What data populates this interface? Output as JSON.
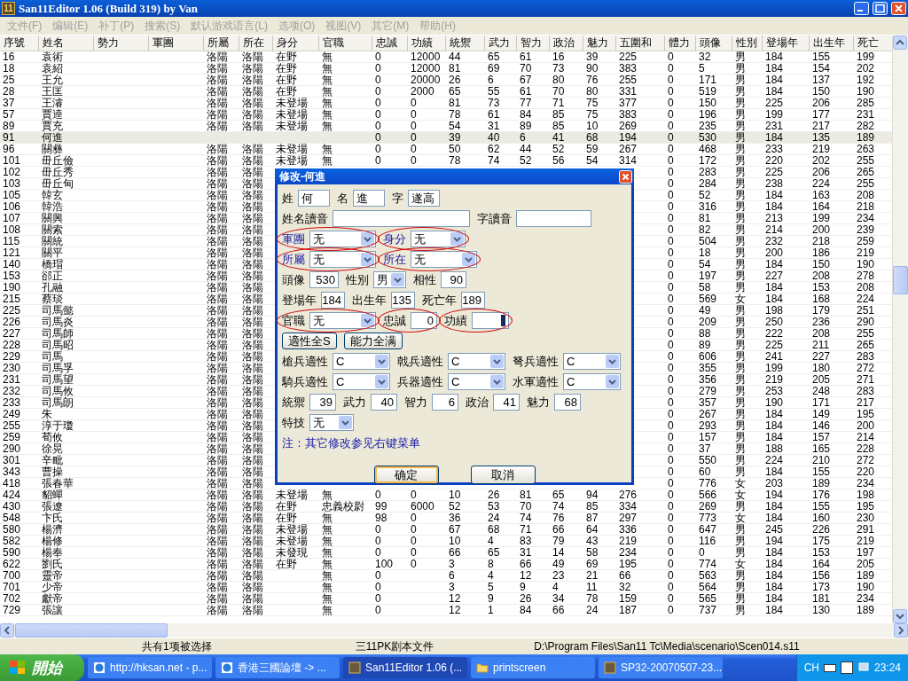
{
  "window": {
    "logo": "11",
    "title": "San11Editor 1.06 (Build 319) by Van"
  },
  "menu": [
    {
      "label": "文件(F)",
      "disabled": true
    },
    {
      "label": "编辑(E)",
      "disabled": true
    },
    {
      "label": "补丁(P)",
      "disabled": true
    },
    {
      "label": "搜索(S)",
      "disabled": true
    },
    {
      "label": "默认游戏语言(L)",
      "disabled": true
    },
    {
      "label": "选项(O)",
      "disabled": true
    },
    {
      "label": "视图(V)",
      "disabled": true
    },
    {
      "label": "其它(M)",
      "disabled": true
    },
    {
      "label": "帮助(H)",
      "disabled": true
    }
  ],
  "table": {
    "columns": [
      "序號",
      "姓名",
      "勢力",
      "軍團",
      "所屬",
      "所在",
      "身分",
      "官職",
      "忠誠",
      "功績",
      "統禦",
      "武力",
      "智力",
      "政治",
      "魅力",
      "五圍和",
      "體力",
      "頭像",
      "性別",
      "登場年",
      "出生年",
      "死亡"
    ],
    "rows": [
      {
        "selected": false,
        "cells": [
          "16",
          "袁術",
          null,
          null,
          "洛陽",
          "洛陽",
          "在野",
          "無",
          "0",
          "12000",
          "44",
          "65",
          "61",
          "16",
          "39",
          "225",
          "0",
          "32",
          "男",
          "184",
          "155",
          "199"
        ]
      },
      {
        "selected": false,
        "cells": [
          "18",
          "袁紹",
          null,
          null,
          "洛陽",
          "洛陽",
          "在野",
          "無",
          "0",
          "12000",
          "81",
          "69",
          "70",
          "73",
          "90",
          "383",
          "0",
          "5",
          "男",
          "184",
          "154",
          "202"
        ]
      },
      {
        "selected": false,
        "cells": [
          "25",
          "王允",
          null,
          null,
          "洛陽",
          "洛陽",
          "在野",
          "無",
          "0",
          "20000",
          "26",
          "6",
          "67",
          "80",
          "76",
          "255",
          "0",
          "171",
          "男",
          "184",
          "137",
          "192"
        ]
      },
      {
        "selected": false,
        "cells": [
          "28",
          "王匡",
          null,
          null,
          "洛陽",
          "洛陽",
          "在野",
          "無",
          "0",
          "2000",
          "65",
          "55",
          "61",
          "70",
          "80",
          "331",
          "0",
          "519",
          "男",
          "184",
          "150",
          "190"
        ]
      },
      {
        "selected": false,
        "cells": [
          "37",
          "王濬",
          null,
          null,
          "洛陽",
          "洛陽",
          "未登場",
          "無",
          "0",
          "0",
          "81",
          "73",
          "77",
          "71",
          "75",
          "377",
          "0",
          "150",
          "男",
          "225",
          "206",
          "285"
        ]
      },
      {
        "selected": false,
        "cells": [
          "57",
          "賈逵",
          null,
          null,
          "洛陽",
          "洛陽",
          "未登場",
          "無",
          "0",
          "0",
          "78",
          "61",
          "84",
          "85",
          "75",
          "383",
          "0",
          "196",
          "男",
          "199",
          "177",
          "231"
        ]
      },
      {
        "selected": false,
        "cells": [
          "89",
          "賈充",
          null,
          null,
          "洛陽",
          "洛陽",
          "未登場",
          "無",
          "0",
          "0",
          "54",
          "31",
          "89",
          "85",
          "10",
          "269",
          "0",
          "235",
          "男",
          "231",
          "217",
          "282"
        ]
      },
      {
        "selected": true,
        "cells": [
          "91",
          "何進",
          null,
          null,
          null,
          null,
          null,
          null,
          "0",
          "0",
          "39",
          "40",
          "6",
          "41",
          "68",
          "194",
          "0",
          "530",
          "男",
          "184",
          "135",
          "189"
        ]
      },
      {
        "selected": false,
        "cells": [
          "96",
          "關彝",
          null,
          null,
          "洛陽",
          "洛陽",
          "未登場",
          "無",
          "0",
          "0",
          "50",
          "62",
          "44",
          "52",
          "59",
          "267",
          "0",
          "468",
          "男",
          "233",
          "219",
          "263"
        ]
      },
      {
        "selected": false,
        "cells": [
          "101",
          "毌丘儉",
          null,
          null,
          "洛陽",
          "洛陽",
          "未登場",
          "無",
          "0",
          "0",
          "78",
          "74",
          "52",
          "56",
          "54",
          "314",
          "0",
          "172",
          "男",
          "220",
          "202",
          "255"
        ]
      },
      {
        "selected": false,
        "cells": [
          "102",
          "毌丘秀",
          null,
          null,
          "洛陽",
          "洛陽",
          null,
          null,
          null,
          null,
          null,
          null,
          null,
          null,
          null,
          null,
          "0",
          "283",
          "男",
          "225",
          "206",
          "265"
        ]
      },
      {
        "selected": false,
        "cells": [
          "103",
          "毌丘甸",
          null,
          null,
          "洛陽",
          "洛陽",
          null,
          null,
          null,
          null,
          null,
          null,
          null,
          null,
          null,
          null,
          "0",
          "284",
          "男",
          "238",
          "224",
          "255"
        ]
      },
      {
        "selected": false,
        "cells": [
          "105",
          "韓玄",
          null,
          null,
          "洛陽",
          "洛陽",
          null,
          null,
          null,
          null,
          null,
          null,
          null,
          null,
          null,
          null,
          "0",
          "52",
          "男",
          "184",
          "163",
          "208"
        ]
      },
      {
        "selected": false,
        "cells": [
          "106",
          "韓浩",
          null,
          null,
          "洛陽",
          "洛陽",
          null,
          null,
          null,
          null,
          null,
          null,
          null,
          null,
          null,
          null,
          "0",
          "316",
          "男",
          "184",
          "164",
          "218"
        ]
      },
      {
        "selected": false,
        "cells": [
          "107",
          "關興",
          null,
          null,
          "洛陽",
          "洛陽",
          null,
          null,
          null,
          null,
          null,
          null,
          null,
          null,
          null,
          null,
          "0",
          "81",
          "男",
          "213",
          "199",
          "234"
        ]
      },
      {
        "selected": false,
        "cells": [
          "108",
          "關索",
          null,
          null,
          "洛陽",
          "洛陽",
          null,
          null,
          null,
          null,
          null,
          null,
          null,
          null,
          null,
          null,
          "0",
          "82",
          "男",
          "214",
          "200",
          "239"
        ]
      },
      {
        "selected": false,
        "cells": [
          "115",
          "關統",
          null,
          null,
          "洛陽",
          "洛陽",
          null,
          null,
          null,
          null,
          null,
          null,
          null,
          null,
          null,
          null,
          "0",
          "504",
          "男",
          "232",
          "218",
          "259"
        ]
      },
      {
        "selected": false,
        "cells": [
          "121",
          "關平",
          null,
          null,
          "洛陽",
          "洛陽",
          null,
          null,
          null,
          null,
          null,
          null,
          null,
          null,
          null,
          null,
          "0",
          "18",
          "男",
          "200",
          "186",
          "219"
        ]
      },
      {
        "selected": false,
        "cells": [
          "140",
          "橋瑁",
          null,
          null,
          "洛陽",
          "洛陽",
          null,
          null,
          null,
          null,
          null,
          null,
          null,
          null,
          null,
          null,
          "0",
          "54",
          "男",
          "184",
          "150",
          "190"
        ]
      },
      {
        "selected": false,
        "cells": [
          "153",
          "郤正",
          null,
          null,
          "洛陽",
          "洛陽",
          null,
          null,
          null,
          null,
          null,
          null,
          null,
          null,
          null,
          null,
          "0",
          "197",
          "男",
          "227",
          "208",
          "278"
        ]
      },
      {
        "selected": false,
        "cells": [
          "190",
          "孔融",
          null,
          null,
          "洛陽",
          "洛陽",
          null,
          null,
          null,
          null,
          null,
          null,
          null,
          null,
          null,
          null,
          "0",
          "58",
          "男",
          "184",
          "153",
          "208"
        ]
      },
      {
        "selected": false,
        "cells": [
          "215",
          "蔡琰",
          null,
          null,
          "洛陽",
          "洛陽",
          null,
          null,
          null,
          null,
          null,
          null,
          null,
          null,
          null,
          null,
          "0",
          "569",
          "女",
          "184",
          "168",
          "224"
        ]
      },
      {
        "selected": false,
        "cells": [
          "225",
          "司馬懿",
          null,
          null,
          "洛陽",
          "洛陽",
          null,
          null,
          null,
          null,
          null,
          null,
          null,
          null,
          null,
          null,
          "0",
          "49",
          "男",
          "198",
          "179",
          "251"
        ]
      },
      {
        "selected": false,
        "cells": [
          "226",
          "司馬炎",
          null,
          null,
          "洛陽",
          "洛陽",
          null,
          null,
          null,
          null,
          null,
          null,
          null,
          null,
          null,
          null,
          "0",
          "209",
          "男",
          "250",
          "236",
          "290"
        ]
      },
      {
        "selected": false,
        "cells": [
          "227",
          "司馬師",
          null,
          null,
          "洛陽",
          "洛陽",
          null,
          null,
          null,
          null,
          null,
          null,
          null,
          null,
          null,
          null,
          "0",
          "88",
          "男",
          "222",
          "208",
          "255"
        ]
      },
      {
        "selected": false,
        "cells": [
          "228",
          "司馬昭",
          null,
          null,
          "洛陽",
          "洛陽",
          null,
          null,
          null,
          null,
          null,
          null,
          null,
          null,
          null,
          null,
          "0",
          "89",
          "男",
          "225",
          "211",
          "265"
        ]
      },
      {
        "selected": false,
        "cells": [
          "229",
          "司馬",
          null,
          null,
          "洛陽",
          "洛陽",
          null,
          null,
          null,
          null,
          null,
          null,
          null,
          null,
          null,
          null,
          "0",
          "606",
          "男",
          "241",
          "227",
          "283"
        ]
      },
      {
        "selected": false,
        "cells": [
          "230",
          "司馬孚",
          null,
          null,
          "洛陽",
          "洛陽",
          null,
          null,
          null,
          null,
          null,
          null,
          null,
          null,
          null,
          null,
          "0",
          "355",
          "男",
          "199",
          "180",
          "272"
        ]
      },
      {
        "selected": false,
        "cells": [
          "231",
          "司馬望",
          null,
          null,
          "洛陽",
          "洛陽",
          null,
          null,
          null,
          null,
          null,
          null,
          null,
          null,
          null,
          null,
          "0",
          "356",
          "男",
          "219",
          "205",
          "271"
        ]
      },
      {
        "selected": false,
        "cells": [
          "232",
          "司馬攸",
          null,
          null,
          "洛陽",
          "洛陽",
          null,
          null,
          null,
          null,
          null,
          null,
          null,
          null,
          null,
          null,
          "0",
          "279",
          "男",
          "253",
          "248",
          "283"
        ]
      },
      {
        "selected": false,
        "cells": [
          "233",
          "司馬朗",
          null,
          null,
          "洛陽",
          "洛陽",
          null,
          null,
          null,
          null,
          null,
          null,
          null,
          null,
          null,
          null,
          "0",
          "357",
          "男",
          "190",
          "171",
          "217"
        ]
      },
      {
        "selected": false,
        "cells": [
          "249",
          "朱",
          null,
          null,
          "洛陽",
          "洛陽",
          null,
          null,
          null,
          null,
          null,
          null,
          null,
          null,
          null,
          null,
          "0",
          "267",
          "男",
          "184",
          "149",
          "195"
        ]
      },
      {
        "selected": false,
        "cells": [
          "255",
          "淳于瓊",
          null,
          null,
          "洛陽",
          "洛陽",
          null,
          null,
          null,
          null,
          null,
          null,
          null,
          null,
          null,
          null,
          "0",
          "293",
          "男",
          "184",
          "146",
          "200"
        ]
      },
      {
        "selected": false,
        "cells": [
          "259",
          "荀攸",
          null,
          null,
          "洛陽",
          "洛陽",
          null,
          null,
          null,
          null,
          null,
          null,
          null,
          null,
          null,
          null,
          "0",
          "157",
          "男",
          "184",
          "157",
          "214"
        ]
      },
      {
        "selected": false,
        "cells": [
          "290",
          "徐晃",
          null,
          null,
          "洛陽",
          "洛陽",
          null,
          null,
          null,
          null,
          null,
          null,
          null,
          null,
          null,
          null,
          "0",
          "37",
          "男",
          "188",
          "165",
          "228"
        ]
      },
      {
        "selected": false,
        "cells": [
          "301",
          "辛毗",
          null,
          null,
          "洛陽",
          "洛陽",
          null,
          null,
          null,
          null,
          null,
          null,
          null,
          null,
          null,
          null,
          "0",
          "550",
          "男",
          "224",
          "210",
          "272"
        ]
      },
      {
        "selected": false,
        "cells": [
          "343",
          "曹操",
          null,
          null,
          "洛陽",
          "洛陽",
          null,
          null,
          null,
          null,
          null,
          null,
          null,
          null,
          null,
          null,
          "0",
          "60",
          "男",
          "184",
          "155",
          "220"
        ]
      },
      {
        "selected": false,
        "cells": [
          "418",
          "張春華",
          null,
          null,
          "洛陽",
          "洛陽",
          null,
          null,
          null,
          null,
          null,
          null,
          null,
          null,
          null,
          null,
          "0",
          "776",
          "女",
          "203",
          "189",
          "234"
        ]
      },
      {
        "selected": false,
        "cells": [
          "424",
          "貂蟬",
          null,
          null,
          "洛陽",
          "洛陽",
          "未登場",
          "無",
          "0",
          "0",
          "10",
          "26",
          "81",
          "65",
          "94",
          "276",
          "0",
          "566",
          "女",
          "194",
          "176",
          "198"
        ]
      },
      {
        "selected": false,
        "cells": [
          "430",
          "張遼",
          null,
          null,
          "洛陽",
          "洛陽",
          "在野",
          "忠義校尉",
          "99",
          "6000",
          "52",
          "53",
          "70",
          "74",
          "85",
          "334",
          "0",
          "269",
          "男",
          "184",
          "155",
          "195"
        ]
      },
      {
        "selected": false,
        "cells": [
          "548",
          "卞氏",
          null,
          null,
          "洛陽",
          "洛陽",
          "在野",
          "無",
          "98",
          "0",
          "36",
          "24",
          "74",
          "76",
          "87",
          "297",
          "0",
          "773",
          "女",
          "184",
          "160",
          "230"
        ]
      },
      {
        "selected": false,
        "cells": [
          "580",
          "楊濟",
          null,
          null,
          "洛陽",
          "洛陽",
          "未登場",
          "無",
          "0",
          "0",
          "67",
          "68",
          "71",
          "66",
          "64",
          "336",
          "0",
          "647",
          "男",
          "245",
          "226",
          "291"
        ]
      },
      {
        "selected": false,
        "cells": [
          "582",
          "楊修",
          null,
          null,
          "洛陽",
          "洛陽",
          "未登場",
          "無",
          "0",
          "0",
          "10",
          "4",
          "83",
          "79",
          "43",
          "219",
          "0",
          "116",
          "男",
          "194",
          "175",
          "219"
        ]
      },
      {
        "selected": false,
        "cells": [
          "590",
          "楊奉",
          null,
          null,
          "洛陽",
          "洛陽",
          "未發現",
          "無",
          "0",
          "0",
          "66",
          "65",
          "31",
          "14",
          "58",
          "234",
          "0",
          "0",
          "男",
          "184",
          "153",
          "197"
        ]
      },
      {
        "selected": false,
        "cells": [
          "622",
          "劉氏",
          null,
          null,
          "洛陽",
          "洛陽",
          "在野",
          "無",
          "100",
          "0",
          "3",
          "8",
          "66",
          "49",
          "69",
          "195",
          "0",
          "774",
          "女",
          "184",
          "164",
          "205"
        ]
      },
      {
        "selected": false,
        "cells": [
          "700",
          "靈帝",
          null,
          null,
          "洛陽",
          "洛陽",
          null,
          "無",
          "0",
          null,
          "6",
          "4",
          "12",
          "23",
          "21",
          "66",
          "0",
          "563",
          "男",
          "184",
          "156",
          "189"
        ]
      },
      {
        "selected": false,
        "cells": [
          "701",
          "少帝",
          null,
          null,
          "洛陽",
          "洛陽",
          null,
          "無",
          "0",
          null,
          "3",
          "5",
          "9",
          "4",
          "11",
          "32",
          "0",
          "564",
          "男",
          "184",
          "173",
          "190"
        ]
      },
      {
        "selected": false,
        "cells": [
          "702",
          "獻帝",
          null,
          null,
          "洛陽",
          "洛陽",
          null,
          "無",
          "0",
          null,
          "12",
          "9",
          "26",
          "34",
          "78",
          "159",
          "0",
          "565",
          "男",
          "184",
          "181",
          "234"
        ]
      },
      {
        "selected": false,
        "cells": [
          "729",
          "張讓",
          null,
          null,
          "洛陽",
          "洛陽",
          null,
          "無",
          "0",
          null,
          "12",
          "1",
          "84",
          "66",
          "24",
          "187",
          "0",
          "737",
          "男",
          "184",
          "130",
          "189"
        ]
      }
    ]
  },
  "dialog": {
    "title": "修改-何進",
    "rows": [
      {
        "kind": "fields",
        "fields": [
          {
            "label": "姓",
            "kind": "text",
            "value": "何"
          },
          {
            "label": "名",
            "kind": "text",
            "value": "進"
          },
          {
            "label": "字",
            "kind": "text",
            "value": "遂高"
          }
        ]
      },
      {
        "kind": "fields",
        "fields": [
          {
            "label": "姓名讀音",
            "kind": "text"
          },
          {
            "label": "字讀音",
            "kind": "text"
          }
        ]
      },
      {
        "kind": "fields",
        "fields": [
          {
            "label": "軍團",
            "kind": "combo",
            "value": "无",
            "circled": true,
            "link": true
          },
          {
            "label": "身分",
            "kind": "combo",
            "value": "无",
            "circled": true,
            "link": true
          }
        ]
      },
      {
        "kind": "fields",
        "fields": [
          {
            "label": "所屬",
            "kind": "combo",
            "value": "无",
            "circled": true,
            "link": true
          },
          {
            "label": "所在",
            "kind": "combo",
            "value": "无",
            "circled": true,
            "link": true
          }
        ]
      },
      {
        "kind": "fields",
        "fields": [
          {
            "label": "頭像",
            "kind": "number",
            "value": "530"
          },
          {
            "label": "性別",
            "kind": "combo",
            "value": "男"
          },
          {
            "label": "相性",
            "kind": "number",
            "value": "90"
          }
        ]
      },
      {
        "kind": "fields",
        "fields": [
          {
            "label": "登場年",
            "kind": "number",
            "value": "184"
          },
          {
            "label": "出生年",
            "kind": "number",
            "value": "135"
          },
          {
            "label": "死亡年",
            "kind": "number",
            "value": "189"
          }
        ]
      },
      {
        "kind": "fields",
        "fields": [
          {
            "label": "官職",
            "kind": "combo",
            "value": "无",
            "circled": true
          },
          {
            "label": "忠誠",
            "kind": "number",
            "value": "0",
            "circled": true
          },
          {
            "label": "功績",
            "kind": "number",
            "circled": true,
            "focused": true
          }
        ]
      },
      {
        "kind": "buttons",
        "buttons": [
          {
            "label": "適性全S"
          },
          {
            "label": "能力全满"
          }
        ]
      },
      {
        "kind": "fields",
        "fields": [
          {
            "label": "槍兵適性",
            "kind": "combo",
            "value": "C"
          },
          {
            "label": "戟兵適性",
            "kind": "combo",
            "value": "C"
          },
          {
            "label": "弩兵適性",
            "kind": "combo",
            "value": "C"
          }
        ]
      },
      {
        "kind": "fields",
        "fields": [
          {
            "label": "騎兵適性",
            "kind": "combo",
            "value": "C"
          },
          {
            "label": "兵器適性",
            "kind": "combo",
            "value": "C"
          },
          {
            "label": "水軍適性",
            "kind": "combo",
            "value": "C"
          }
        ]
      },
      {
        "kind": "fields",
        "fields": [
          {
            "label": "統禦",
            "kind": "number",
            "value": "39"
          },
          {
            "label": "武力",
            "kind": "number",
            "value": "40"
          },
          {
            "label": "智力",
            "kind": "number",
            "value": "6"
          },
          {
            "label": "政治",
            "kind": "number",
            "value": "41"
          },
          {
            "label": "魅力",
            "kind": "number",
            "value": "68"
          }
        ]
      },
      {
        "kind": "fields",
        "fields": [
          {
            "label": "特技",
            "kind": "combo",
            "value": "无"
          }
        ]
      },
      {
        "kind": "note",
        "text": "注：其它修改参见右键菜单"
      }
    ],
    "footer": [
      {
        "label": "确定",
        "default": true
      },
      {
        "label": "取消",
        "default": false
      }
    ]
  },
  "status_bar": [
    "共有1项被选择",
    "三11PK剧本文件",
    "D:\\Program Files\\San11 Tc\\Media\\scenario\\Scen014.s11"
  ],
  "taskbar": {
    "start": "開始",
    "tasks": [
      {
        "label": "http://hksan.net - p...",
        "selected": false,
        "kind": "browser"
      },
      {
        "label": "香港三國論壇 -> ...",
        "selected": false,
        "kind": "browser"
      },
      {
        "label": "San11Editor 1.06 (...",
        "selected": true,
        "kind": "app"
      },
      {
        "label": "printscreen",
        "selected": false,
        "kind": "folder"
      },
      {
        "label": "SP32-20070507-23...",
        "selected": false,
        "kind": "app"
      }
    ],
    "language": "CH",
    "clock": "23:24"
  }
}
